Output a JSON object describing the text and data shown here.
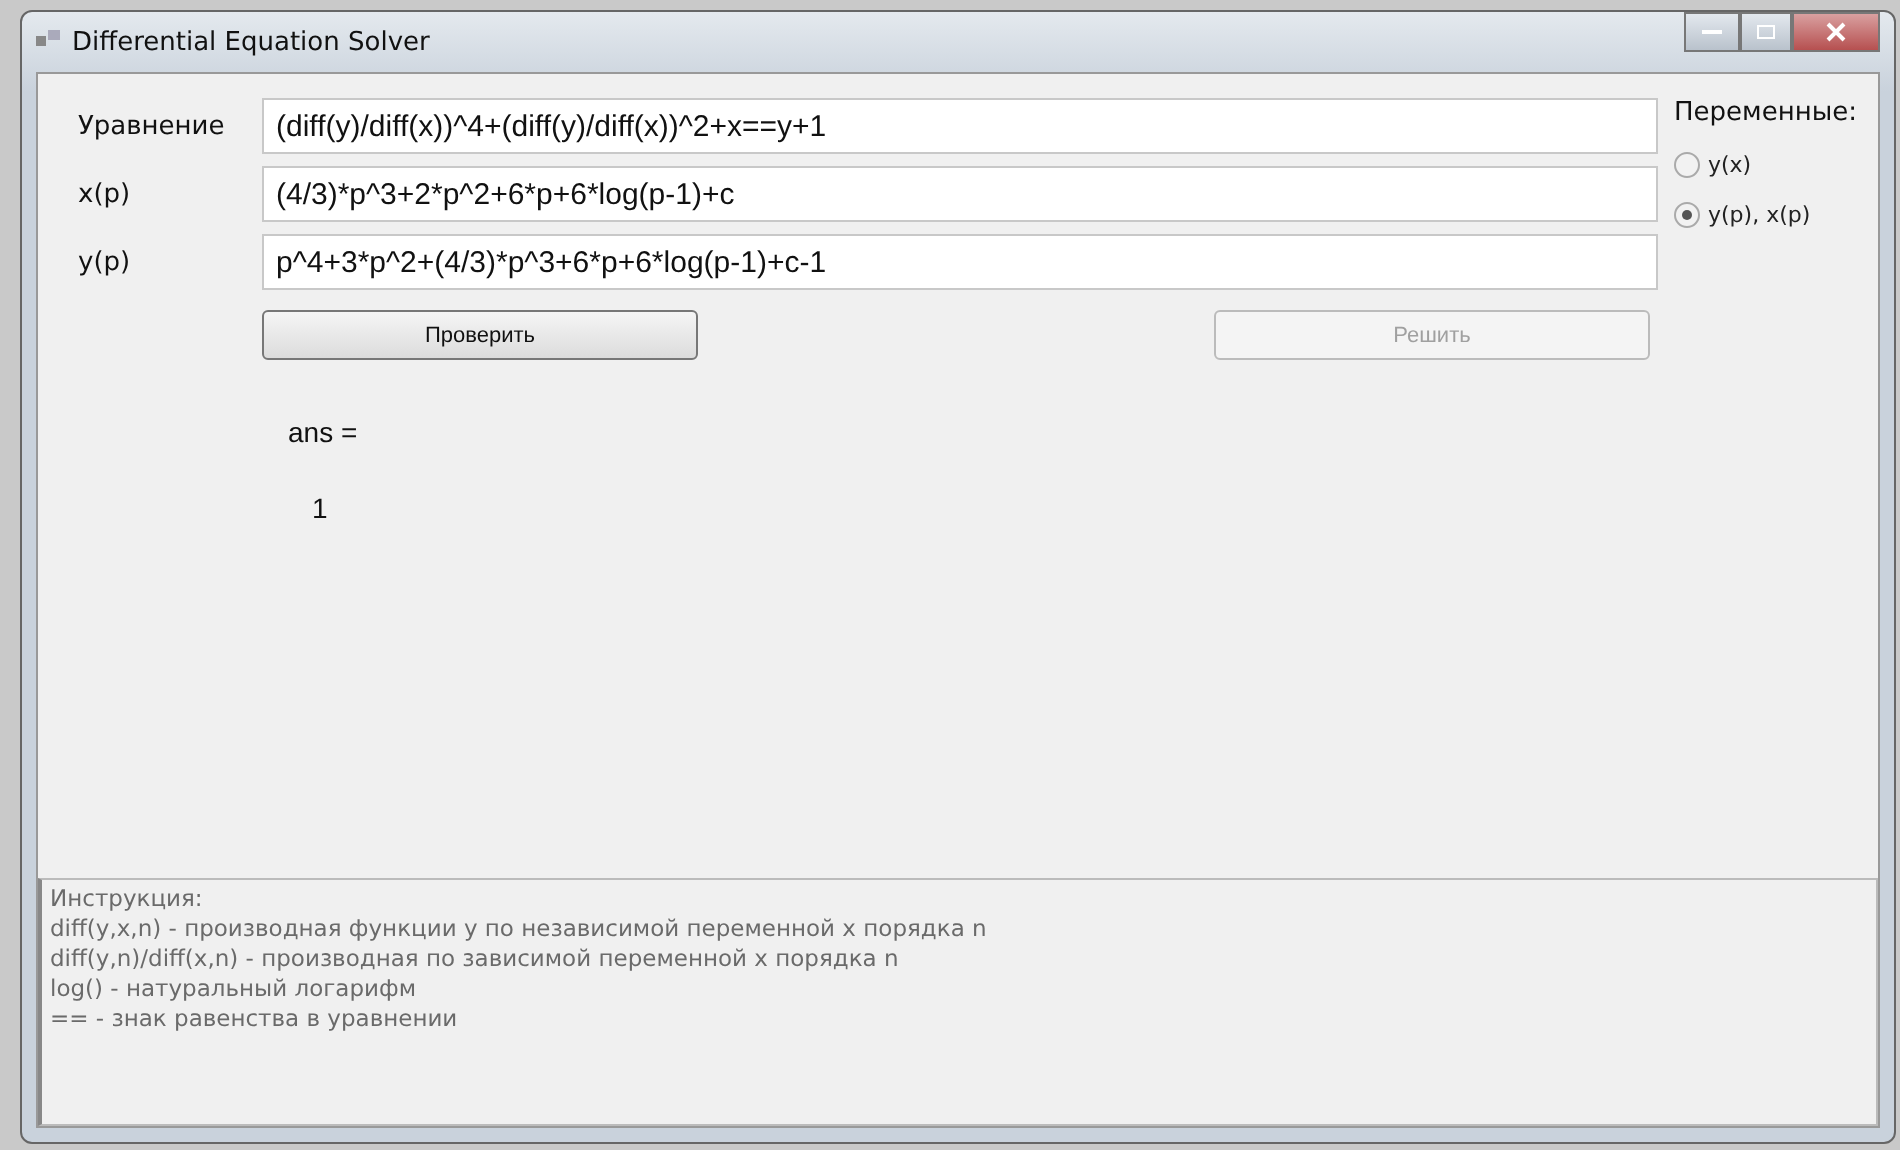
{
  "window": {
    "title": "Differential Equation Solver"
  },
  "fields": [
    {
      "label": "Уравнение",
      "value": "(diff(y)/diff(x))^4+(diff(y)/diff(x))^2+x==y+1"
    },
    {
      "label": "x(p)",
      "value": "(4/3)*p^3+2*p^2+6*p+6*log(p-1)+c"
    },
    {
      "label": "y(p)",
      "value": "p^4+3*p^2+(4/3)*p^3+6*p+6*log(p-1)+c-1"
    }
  ],
  "buttons": [
    {
      "label": "Проверить",
      "disabled": false
    },
    {
      "label": "Решить",
      "disabled": true
    }
  ],
  "variables": {
    "title": "Переменные:",
    "options": [
      {
        "label": "y(x)",
        "selected": false
      },
      {
        "label": "y(p), x(p)",
        "selected": true
      }
    ]
  },
  "output": [
    "ans =",
    "1"
  ],
  "instructions": [
    "Инструкция:",
    "diff(y,x,n) - производная функции y по независимой переменной x порядка n",
    "diff(y,n)/diff(x,n) - производная по зависимой переменной x порядка n",
    "log() - натуральный логарифм",
    "== - знак равенства в уравнении"
  ]
}
